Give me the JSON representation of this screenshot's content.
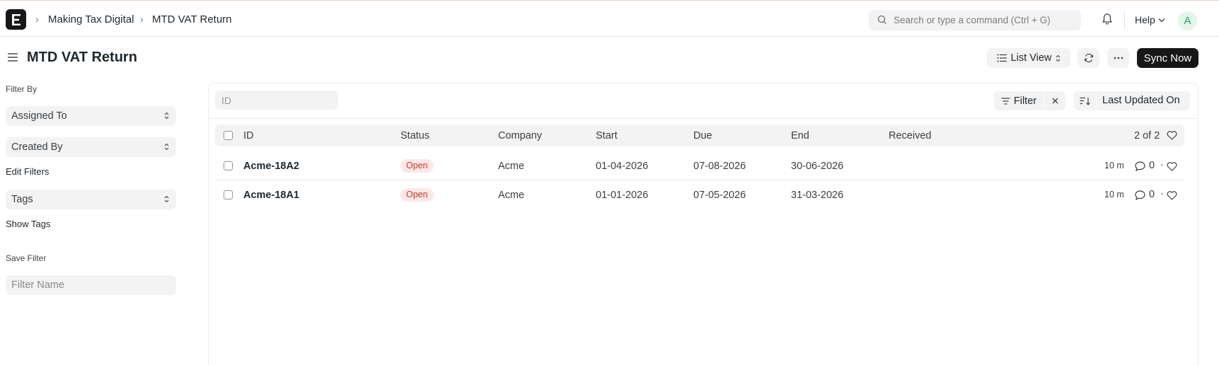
{
  "app": {
    "logo_letter": "E"
  },
  "breadcrumb": [
    "Making Tax Digital",
    "MTD VAT Return"
  ],
  "search": {
    "placeholder": "Search or type a command (Ctrl + G)"
  },
  "navbar": {
    "help_label": "Help",
    "avatar_initial": "A"
  },
  "page": {
    "title": "MTD VAT Return"
  },
  "toolbar": {
    "list_view_label": "List View",
    "sync_label": "Sync Now"
  },
  "sidebar": {
    "filter_by_label": "Filter By",
    "assigned_to": "Assigned To",
    "created_by": "Created By",
    "edit_filters": "Edit Filters",
    "tags": "Tags",
    "show_tags": "Show Tags",
    "save_filter_label": "Save Filter",
    "filter_name_placeholder": "Filter Name"
  },
  "list": {
    "id_placeholder": "ID",
    "filter_label": "Filter",
    "sort_label": "Last Updated On",
    "columns": [
      "ID",
      "Status",
      "Company",
      "Start",
      "Due",
      "End",
      "Received"
    ],
    "count": "2 of 2",
    "rows": [
      {
        "id": "Acme-18A2",
        "status": "Open",
        "company": "Acme",
        "start": "01-04-2026",
        "due": "07-08-2026",
        "end": "30-06-2026",
        "received": "",
        "modified": "10 m",
        "comments": "0"
      },
      {
        "id": "Acme-18A1",
        "status": "Open",
        "company": "Acme",
        "start": "01-01-2026",
        "due": "07-05-2026",
        "end": "31-03-2026",
        "received": "",
        "modified": "10 m",
        "comments": "0"
      }
    ]
  }
}
